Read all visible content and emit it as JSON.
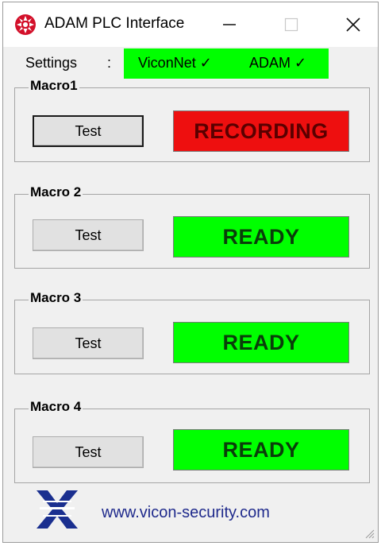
{
  "window": {
    "title": "ADAM PLC Interface",
    "controls": [
      "minimize",
      "maximize",
      "close"
    ]
  },
  "menu": {
    "settings_label": "Settings",
    "separator": ":"
  },
  "status_strip": {
    "viconnet": "ViconNet ✓",
    "adam": "ADAM ✓",
    "color": "#00ff00"
  },
  "macros": [
    {
      "label": "Macro1",
      "button": "Test",
      "status": "RECORDING",
      "status_color": "#ee0f0f"
    },
    {
      "label": "Macro 2",
      "button": "Test",
      "status": "READY",
      "status_color": "#00ff00"
    },
    {
      "label": "Macro 3",
      "button": "Test",
      "status": "READY",
      "status_color": "#00ff00"
    },
    {
      "label": "Macro 4",
      "button": "Test",
      "status": "READY",
      "status_color": "#00ff00"
    }
  ],
  "footer": {
    "logo": "vicon-logo-icon",
    "url": "www.vicon-security.com"
  }
}
